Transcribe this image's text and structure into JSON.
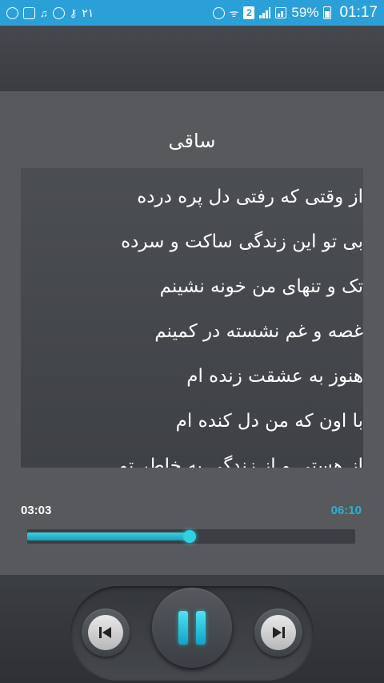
{
  "status_bar": {
    "left_number": "۲۱",
    "badge": "2",
    "battery_percent": "59%",
    "time": "01:17",
    "color": "#2ba0d8"
  },
  "song": {
    "title": "ساقی"
  },
  "lyrics": [
    "از وقتی که رفتی دل پره درده",
    "بی تو این زندگی ساکت و سرده",
    "تک و تنهای من خونه نشینم",
    "غصه و غم نشسته در کمینم",
    "هنوز به عشقت زنده ام",
    "با اون که من دل کنده ام",
    "از هستی و از زندگی به خاطر تو"
  ],
  "player": {
    "current_time": "03:03",
    "total_time": "06:10",
    "progress": 0.4946,
    "accent": "#27b3d6",
    "controls": {
      "prev_icon": "skip-previous-icon",
      "play_pause_icon": "pause-icon",
      "next_icon": "skip-next-icon"
    }
  }
}
